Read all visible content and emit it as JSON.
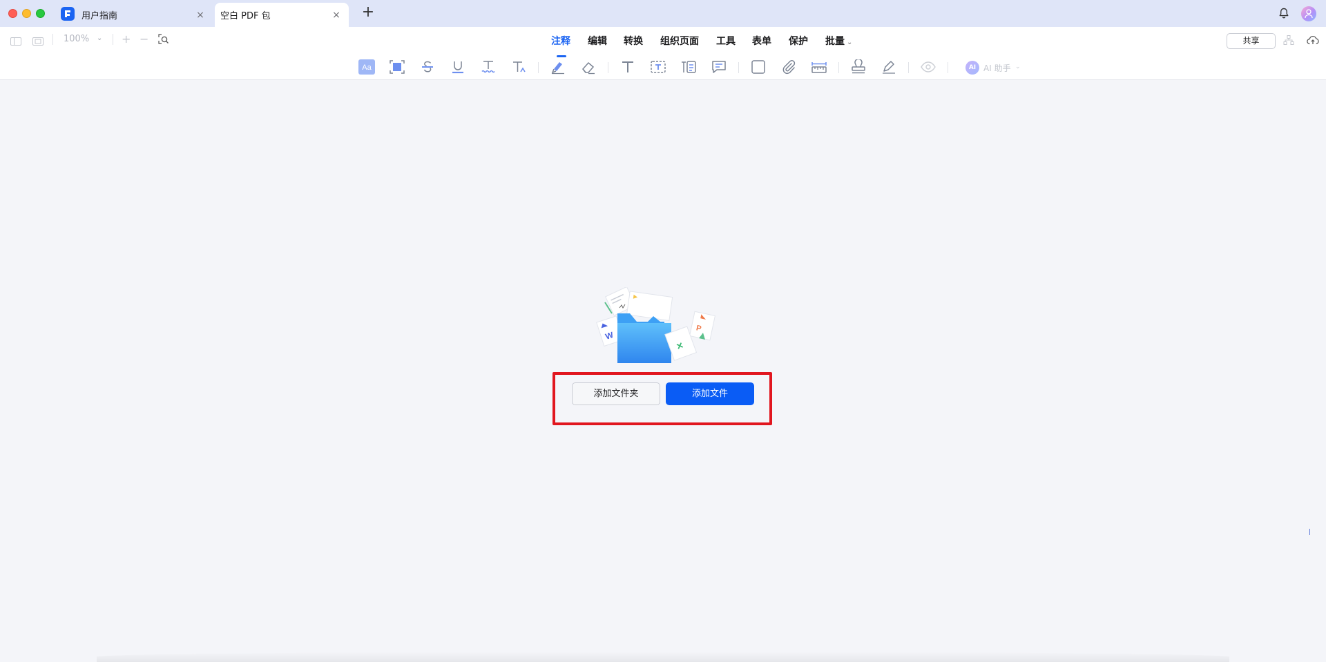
{
  "tabs": [
    {
      "label": "用户指南",
      "close": "×"
    },
    {
      "label": "空白 PDF 包",
      "close": "×",
      "active": true
    }
  ],
  "new_tab": "+",
  "zoom": {
    "value": "100%",
    "caret": "⌄",
    "zoom_in": "+",
    "zoom_out": "−"
  },
  "menu": {
    "items": [
      "注释",
      "编辑",
      "转换",
      "组织页面",
      "工具",
      "表单",
      "保护",
      "批量"
    ],
    "active": "注释",
    "batch_caret": "⌄"
  },
  "share_label": "共享",
  "annotation_tools": [
    "text-style-icon",
    "area-highlight-icon",
    "strikethrough-icon",
    "underline-icon",
    "squiggly-icon",
    "insert-text-icon",
    "highlighter-icon",
    "eraser-icon",
    "typewriter-icon",
    "text-box-icon",
    "callout-icon",
    "comment-icon",
    "rectangle-icon",
    "attachment-icon",
    "measure-icon",
    "stamp-icon",
    "signature-icon",
    "eye-icon"
  ],
  "ai": {
    "badge": "AI",
    "label": "AI 助手",
    "caret": "⌄"
  },
  "empty_state": {
    "add_folder_label": "添加文件夹",
    "add_file_label": "添加文件"
  },
  "colors": {
    "accent": "#1b64f2",
    "primary_button": "#0a5cf5",
    "highlight_border": "#e1161f",
    "tabbar_bg": "#dfe5f8",
    "canvas_bg": "#f4f5f9"
  }
}
